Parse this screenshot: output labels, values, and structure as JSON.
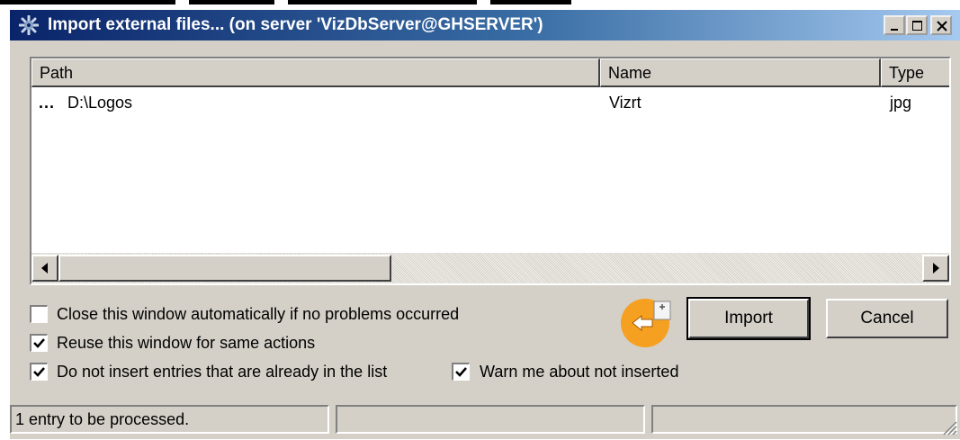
{
  "window": {
    "title": "Import external files... (on server 'VizDbServer@GHSERVER')",
    "icon": "gear-icon",
    "controls": [
      "minimize-icon",
      "maximize-icon",
      "close-icon"
    ]
  },
  "list": {
    "columns": [
      "Path",
      "Name",
      "Type"
    ],
    "rows": [
      {
        "prefix": "...",
        "path": "D:\\Logos",
        "name": "Vizrt",
        "type": "jpg"
      }
    ]
  },
  "options": {
    "close_auto": {
      "label": "Close this window automatically if no problems occurred",
      "checked": false
    },
    "reuse_window": {
      "label": "Reuse this window for same actions",
      "checked": true
    },
    "no_duplicates": {
      "label": "Do not insert entries that are already in the list",
      "checked": true
    },
    "warn_not_inserted": {
      "label": "Warn me about not inserted",
      "checked": true
    }
  },
  "buttons": {
    "import": "Import",
    "cancel": "Cancel"
  },
  "status": {
    "icon": "import-arrow-icon",
    "text": "1 entry to be processed.",
    "panel2": "",
    "panel3": ""
  },
  "colors": {
    "accent": "#f5a020",
    "title_gradient_start": "#0a246a",
    "title_gradient_end": "#a6caf0"
  }
}
